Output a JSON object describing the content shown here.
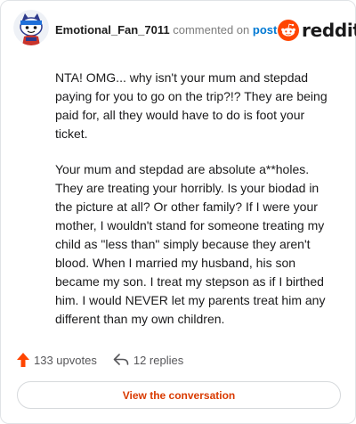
{
  "header": {
    "username": "Emotional_Fan_7011",
    "commented_text": "commented on",
    "post_link": "post",
    "brand_word": "reddit",
    "avatar_icon": "user-avatar-icon",
    "brand_icon": "reddit-snoo-icon"
  },
  "comment": {
    "paragraphs": [
      "NTA! OMG... why isn't your mum and stepdad paying for you to go on the trip?!? They are being paid for, all they would have to do is foot your ticket.",
      "Your mum and stepdad are absolute a**holes. They are treating your horribly. Is your biodad in the picture at all? Or other family? If I were your mother, I wouldn't stand for someone treating my child as \"less than\" simply because they aren't blood. When I married my husband, his son became my son. I treat my stepson as if I birthed him. I would NEVER let my parents treat him any different than my own children."
    ]
  },
  "actions": {
    "upvotes": "133 upvotes",
    "replies": "12 replies",
    "upvote_icon": "upvote-arrow-icon",
    "reply_icon": "reply-arrow-icon"
  },
  "cta": {
    "label": "View the conversation"
  },
  "colors": {
    "brand_orange": "#ff4500",
    "link_blue": "#0079d3",
    "cta_text": "#d93a00",
    "muted": "#7c7c7c"
  }
}
